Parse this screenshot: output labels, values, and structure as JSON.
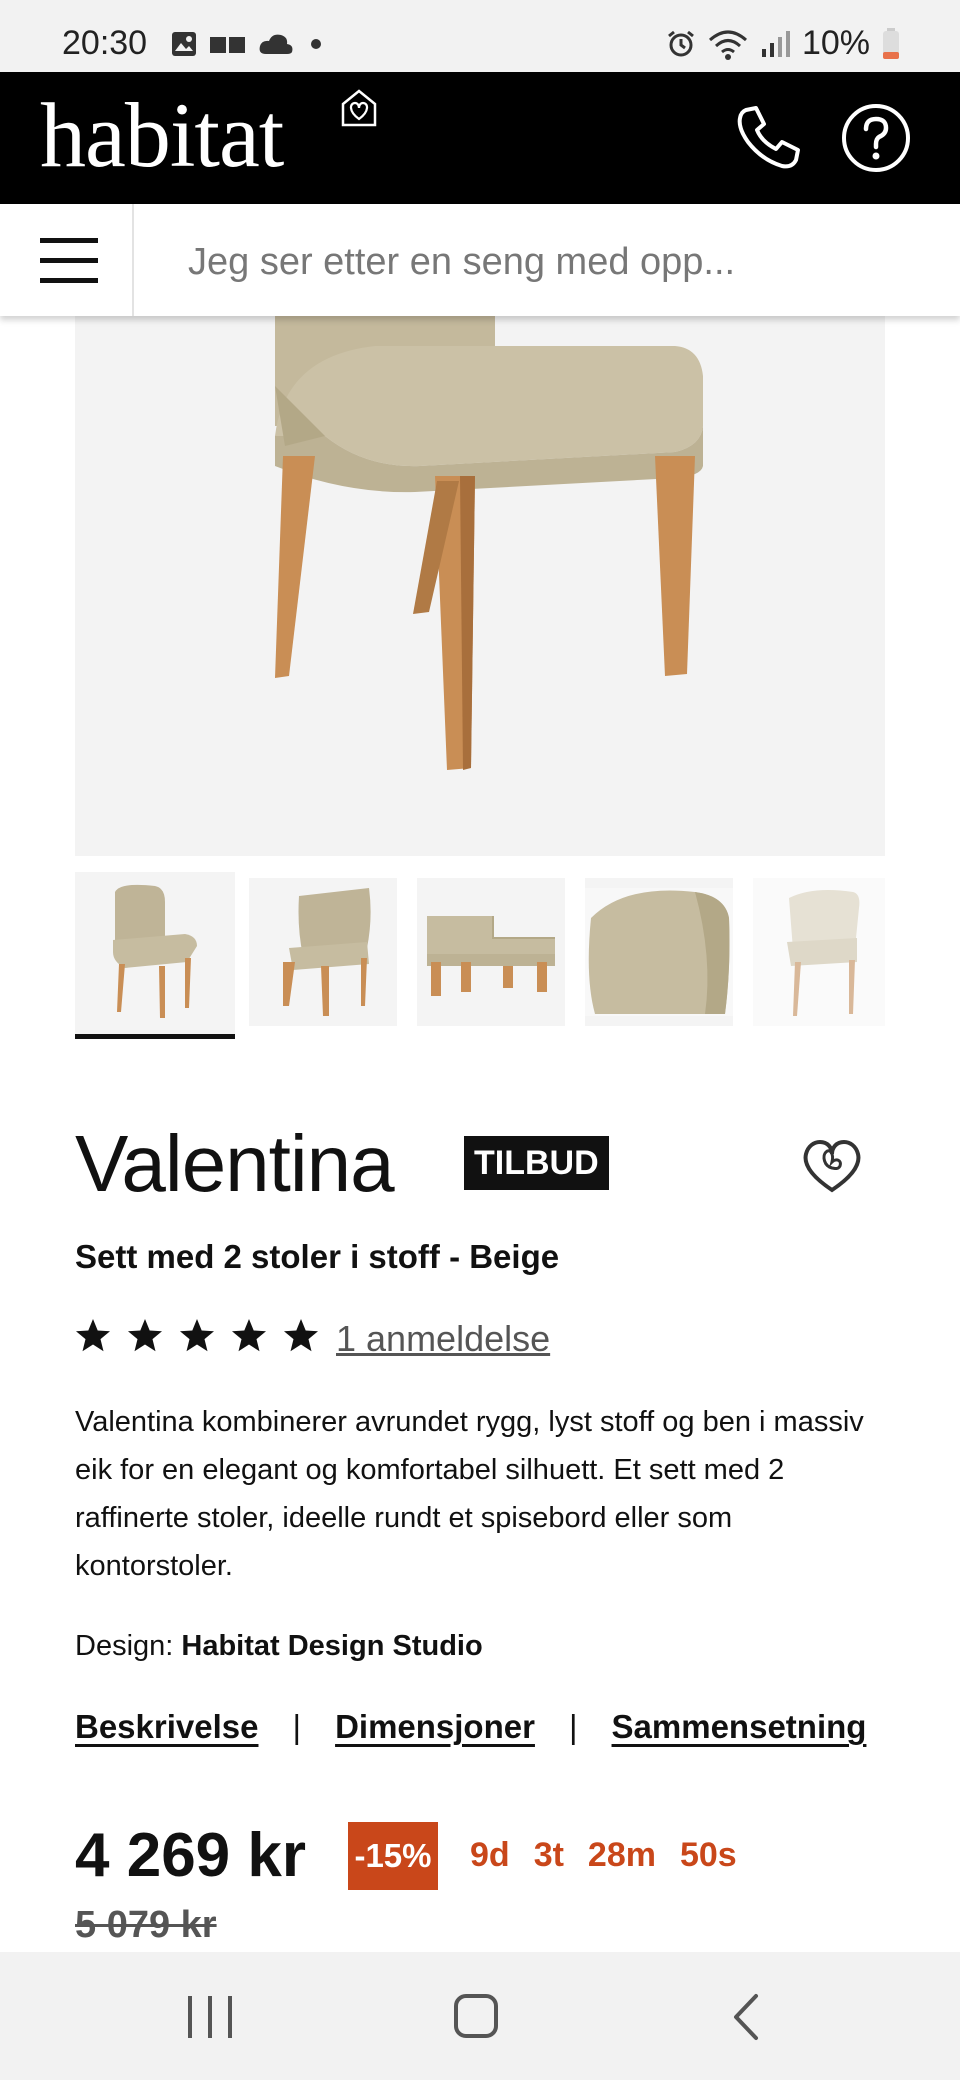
{
  "status_bar": {
    "time": "20:30",
    "battery": "10%",
    "icons_left": [
      "image-icon",
      "cards-icon",
      "cloud-icon",
      "dot-icon"
    ],
    "icons_right": [
      "alarm-icon",
      "wifi-icon",
      "signal-icon",
      "battery-icon"
    ]
  },
  "header": {
    "logo": "habitat",
    "phone_icon": "phone-icon",
    "help_icon": "help-icon"
  },
  "search": {
    "placeholder": "Jeg ser etter en seng med opp..."
  },
  "product": {
    "name": "Valentina",
    "badge": "TILBUD",
    "subtitle": "Sett med 2 stoler i stoff - Beige",
    "rating": 5,
    "reviews_label": "1 anmeldelse",
    "description": "Valentina kombinerer avrundet rygg, lyst stoff og ben i massiv eik for en elegant og komfortabel silhuett. Et sett med 2 raffinerte stoler, ideelle rundt et spisebord eller som kontorstoler.",
    "design_label": "Design:",
    "designer": "Habitat Design Studio",
    "tabs": [
      "Beskrivelse",
      "Dimensjoner",
      "Sammensetning"
    ],
    "price": "4 269 kr",
    "discount": "-15%",
    "countdown": [
      "9d",
      "3t",
      "28m",
      "50s"
    ],
    "old_price": "5 079 kr",
    "thumbnail_count": 5,
    "active_thumbnail": 1
  },
  "colors": {
    "header_bg": "#000000",
    "accent": "#c9471a",
    "fabric": "#c9bfa3",
    "wood": "#c98e55"
  }
}
